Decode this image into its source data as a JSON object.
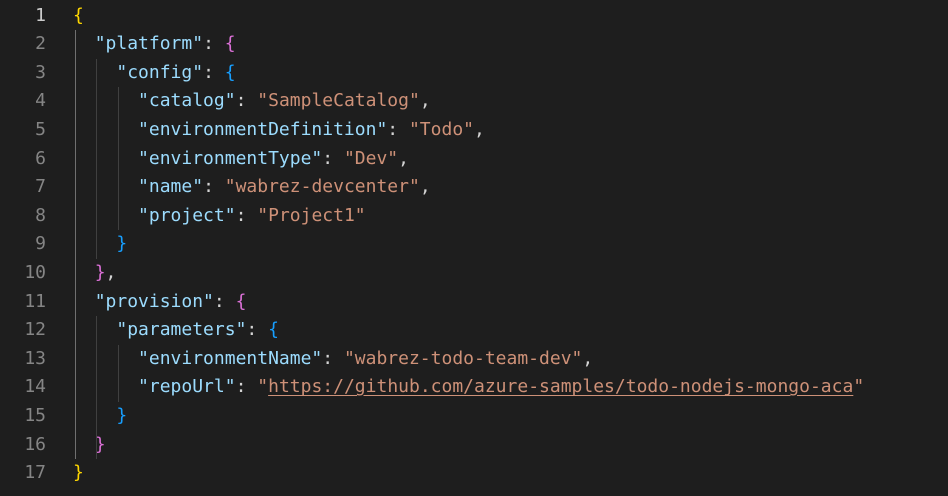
{
  "editor": {
    "language": "json",
    "active_line": 1,
    "lines": [
      {
        "n": "1",
        "tokens": [
          {
            "t": "{",
            "c": "b1"
          }
        ]
      },
      {
        "n": "2",
        "tokens": [
          {
            "t": "  "
          },
          {
            "t": "\"platform\"",
            "c": "key"
          },
          {
            "t": ": "
          },
          {
            "t": "{",
            "c": "b2"
          }
        ]
      },
      {
        "n": "3",
        "tokens": [
          {
            "t": "    "
          },
          {
            "t": "\"config\"",
            "c": "key"
          },
          {
            "t": ": "
          },
          {
            "t": "{",
            "c": "b3"
          }
        ]
      },
      {
        "n": "4",
        "tokens": [
          {
            "t": "      "
          },
          {
            "t": "\"catalog\"",
            "c": "key"
          },
          {
            "t": ": "
          },
          {
            "t": "\"SampleCatalog\"",
            "c": "str"
          },
          {
            "t": ","
          }
        ]
      },
      {
        "n": "5",
        "tokens": [
          {
            "t": "      "
          },
          {
            "t": "\"environmentDefinition\"",
            "c": "key"
          },
          {
            "t": ": "
          },
          {
            "t": "\"Todo\"",
            "c": "str"
          },
          {
            "t": ","
          }
        ]
      },
      {
        "n": "6",
        "tokens": [
          {
            "t": "      "
          },
          {
            "t": "\"environmentType\"",
            "c": "key"
          },
          {
            "t": ": "
          },
          {
            "t": "\"Dev\"",
            "c": "str"
          },
          {
            "t": ","
          }
        ]
      },
      {
        "n": "7",
        "tokens": [
          {
            "t": "      "
          },
          {
            "t": "\"name\"",
            "c": "key"
          },
          {
            "t": ": "
          },
          {
            "t": "\"wabrez-devcenter\"",
            "c": "str"
          },
          {
            "t": ","
          }
        ]
      },
      {
        "n": "8",
        "tokens": [
          {
            "t": "      "
          },
          {
            "t": "\"project\"",
            "c": "key"
          },
          {
            "t": ": "
          },
          {
            "t": "\"Project1\"",
            "c": "str"
          }
        ]
      },
      {
        "n": "9",
        "tokens": [
          {
            "t": "    "
          },
          {
            "t": "}",
            "c": "b3"
          }
        ]
      },
      {
        "n": "10",
        "tokens": [
          {
            "t": "  "
          },
          {
            "t": "}",
            "c": "b2"
          },
          {
            "t": ","
          }
        ]
      },
      {
        "n": "11",
        "tokens": [
          {
            "t": "  "
          },
          {
            "t": "\"provision\"",
            "c": "key"
          },
          {
            "t": ": "
          },
          {
            "t": "{",
            "c": "b2"
          }
        ]
      },
      {
        "n": "12",
        "tokens": [
          {
            "t": "    "
          },
          {
            "t": "\"parameters\"",
            "c": "key"
          },
          {
            "t": ": "
          },
          {
            "t": "{",
            "c": "b3"
          }
        ]
      },
      {
        "n": "13",
        "tokens": [
          {
            "t": "      "
          },
          {
            "t": "\"environmentName\"",
            "c": "key"
          },
          {
            "t": ": "
          },
          {
            "t": "\"wabrez-todo-team-dev\"",
            "c": "str"
          },
          {
            "t": ","
          }
        ]
      },
      {
        "n": "14",
        "tokens": [
          {
            "t": "      "
          },
          {
            "t": "\"repoUrl\"",
            "c": "key"
          },
          {
            "t": ": "
          },
          {
            "t": "\"",
            "c": "str"
          },
          {
            "t": "https://github.com/azure-samples/todo-nodejs-mongo-aca",
            "c": "str link"
          },
          {
            "t": "\"",
            "c": "str"
          }
        ]
      },
      {
        "n": "15",
        "tokens": [
          {
            "t": "    "
          },
          {
            "t": "}",
            "c": "b3"
          }
        ]
      },
      {
        "n": "16",
        "tokens": [
          {
            "t": "  "
          },
          {
            "t": "}",
            "c": "b2"
          }
        ]
      },
      {
        "n": "17",
        "tokens": [
          {
            "t": "}",
            "c": "b1"
          }
        ]
      }
    ]
  }
}
